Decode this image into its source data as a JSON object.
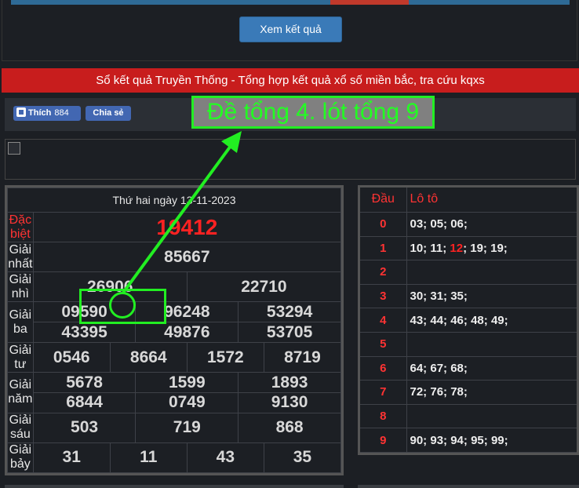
{
  "header": {
    "button_label": "Xem kết quả"
  },
  "banner": {
    "text": "Sổ kết quả Truyền Thống - Tổng hợp kết quả xổ số miền bắc, tra cứu kqxs"
  },
  "social": {
    "like_label": "Thích",
    "like_count": "884",
    "share_label": "Chia sẻ"
  },
  "overlay": {
    "text": "Đề tổng 4. lót tổng 9"
  },
  "results": {
    "date": "Thứ hai ngày 13-11-2023",
    "prizes": [
      {
        "label": "Đặc biệt",
        "rows": [
          [
            "19412"
          ]
        ]
      },
      {
        "label": "Giải nhất",
        "rows": [
          [
            "85667"
          ]
        ]
      },
      {
        "label": "Giải nhì",
        "rows": [
          [
            "26906",
            "22710"
          ]
        ]
      },
      {
        "label": "Giải ba",
        "rows": [
          [
            "09590",
            "96248",
            "53294"
          ],
          [
            "43395",
            "49876",
            "53705"
          ]
        ]
      },
      {
        "label": "Giải tư",
        "rows": [
          [
            "0546",
            "8664",
            "1572",
            "8719"
          ]
        ]
      },
      {
        "label": "Giải năm",
        "rows": [
          [
            "5678",
            "1599",
            "1893"
          ],
          [
            "6844",
            "0749",
            "9130"
          ]
        ]
      },
      {
        "label": "Giải sáu",
        "rows": [
          [
            "503",
            "719",
            "868"
          ]
        ]
      },
      {
        "label": "Giải bảy",
        "rows": [
          [
            "31",
            "11",
            "43",
            "35"
          ]
        ]
      }
    ]
  },
  "loto": {
    "header_dau": "Đầu",
    "header_loto": "Lô tô",
    "rows": [
      {
        "dau": "0",
        "nums": [
          [
            "03;",
            false
          ],
          [
            "05;",
            false
          ],
          [
            "06;",
            false
          ]
        ]
      },
      {
        "dau": "1",
        "nums": [
          [
            "10;",
            false
          ],
          [
            "11;",
            false
          ],
          [
            "12",
            true
          ],
          [
            ";",
            false
          ],
          [
            "19;",
            false
          ],
          [
            "19;",
            false
          ]
        ]
      },
      {
        "dau": "2",
        "nums": []
      },
      {
        "dau": "3",
        "nums": [
          [
            "30;",
            false
          ],
          [
            "31;",
            false
          ],
          [
            "35;",
            false
          ]
        ]
      },
      {
        "dau": "4",
        "nums": [
          [
            "43;",
            false
          ],
          [
            "44;",
            false
          ],
          [
            "46;",
            false
          ],
          [
            "48;",
            false
          ],
          [
            "49;",
            false
          ]
        ]
      },
      {
        "dau": "5",
        "nums": []
      },
      {
        "dau": "6",
        "nums": [
          [
            "64;",
            false
          ],
          [
            "67;",
            false
          ],
          [
            "68;",
            false
          ]
        ]
      },
      {
        "dau": "7",
        "nums": [
          [
            "72;",
            false
          ],
          [
            "76;",
            false
          ],
          [
            "78;",
            false
          ]
        ]
      },
      {
        "dau": "8",
        "nums": []
      },
      {
        "dau": "9",
        "nums": [
          [
            "90;",
            false
          ],
          [
            "93;",
            false
          ],
          [
            "94;",
            false
          ],
          [
            "95;",
            false
          ],
          [
            "99;",
            false
          ]
        ]
      }
    ]
  },
  "colors": {
    "accent_red": "#ff2222",
    "annotation_green": "#22ee22",
    "button_blue": "#3a7ab8"
  }
}
